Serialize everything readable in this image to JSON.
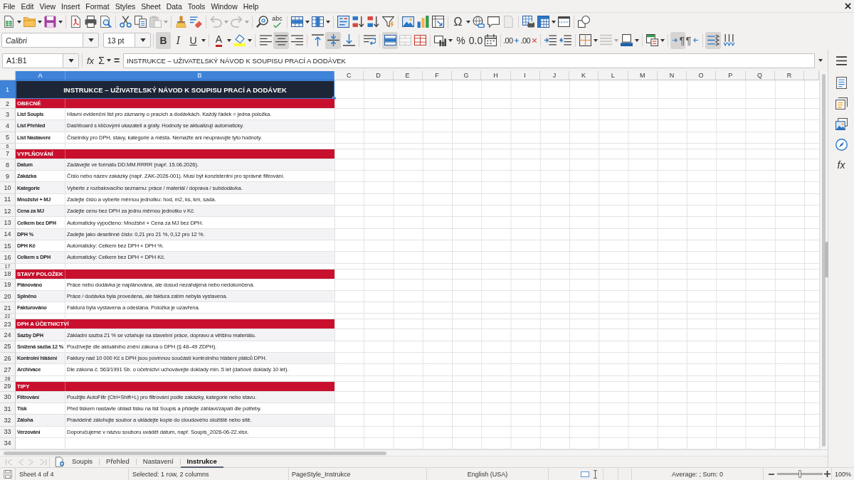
{
  "menu_bar": [
    "File",
    "Edit",
    "View",
    "Insert",
    "Format",
    "Styles",
    "Sheet",
    "Data",
    "Tools",
    "Window",
    "Help"
  ],
  "standard_toolbar": {
    "paste": {
      "disabled": true
    },
    "undo": {
      "disabled": true
    },
    "redo": {
      "disabled": true
    },
    "spelling": {
      "glyph": "abc"
    },
    "special_character": {
      "glyph": "Ω"
    },
    "headers_footers": {
      "disabled": true
    }
  },
  "formatting_toolbar": {
    "font_name": "Calibri",
    "font_size": "13 pt",
    "bold": {
      "glyph": "B",
      "on": true
    },
    "italic": {
      "glyph": "I",
      "on": false
    },
    "underline": {
      "glyph": "U",
      "on": false
    },
    "font_color": {
      "glyph": "A"
    },
    "align_left": {
      "on": false
    },
    "align_center": {
      "on": true
    },
    "align_right": {
      "on": false
    },
    "align_top": {
      "on": false
    },
    "align_middle": {
      "on": true
    },
    "align_bottom": {
      "on": false
    },
    "wrap_text": {
      "on": false
    },
    "merge_and_center": {
      "on": true
    },
    "merge_cells": {
      "disabled": true
    },
    "percent": {
      "glyph": "%"
    },
    "standard_format": {
      "glyph": "0.0"
    },
    "add_decimal": {
      "glyph": ".00"
    },
    "delete_decimal": {
      "glyph": ".00"
    },
    "border_style": {
      "disabled": true
    },
    "left_to_right": {
      "glyph": "¶",
      "on": true
    },
    "right_to_left": {
      "glyph": "¶",
      "on": false
    },
    "text_horizontal": {
      "on": true
    },
    "text_vertical": {
      "on": false
    }
  },
  "formula_bar": {
    "name_box": "A1:B1",
    "function_wizard": "fx",
    "sum": "Σ",
    "formula": "=",
    "content": "INSTRUKCE – UŽIVATELSKÝ NÁVOD K SOUPISU PRACÍ A DODÁVEK"
  },
  "columns": [
    {
      "label": "A",
      "selected": true
    },
    {
      "label": "B",
      "selected": true
    },
    {
      "label": "C",
      "selected": false
    },
    {
      "label": "D",
      "selected": false
    },
    {
      "label": "E",
      "selected": false
    },
    {
      "label": "F",
      "selected": false
    },
    {
      "label": "G",
      "selected": false
    },
    {
      "label": "H",
      "selected": false
    },
    {
      "label": "I",
      "selected": false
    },
    {
      "label": "J",
      "selected": false
    },
    {
      "label": "K",
      "selected": false
    },
    {
      "label": "L",
      "selected": false
    },
    {
      "label": "M",
      "selected": false
    },
    {
      "label": "N",
      "selected": false
    },
    {
      "label": "O",
      "selected": false
    },
    {
      "label": "P",
      "selected": false
    },
    {
      "label": "Q",
      "selected": false
    },
    {
      "label": "R",
      "selected": false
    }
  ],
  "rows": [
    {
      "number": "1",
      "selected": true,
      "kind": "title",
      "text": "INSTRUKCE – UŽIVATELSKÝ NÁVOD K SOUPISU PRACÍ A DODÁVEK"
    },
    {
      "number": "2",
      "selected": false,
      "kind": "section",
      "text": "OBECNÉ"
    },
    {
      "number": "3",
      "selected": false,
      "kind": "entry",
      "label": "List Soupis",
      "text": "Hlavní evidenční list pro záznamy o pracích a dodávkách. Každý řádek = jedna položka."
    },
    {
      "number": "4",
      "selected": false,
      "kind": "entry",
      "label": "List Přehled",
      "text": "Dashboard s klíčovými ukazateli a grafy. Hodnoty se aktualizují automaticky."
    },
    {
      "number": "5",
      "selected": false,
      "kind": "entry",
      "label": "List Nastavení",
      "text": "Číselníky pro DPH, stavy, kategorie a města. Nemažte ani neupravujte tyto hodnoty."
    },
    {
      "number": "6",
      "selected": false,
      "kind": "spacer"
    },
    {
      "number": "7",
      "selected": false,
      "kind": "section",
      "text": "VYPLŇOVÁNÍ"
    },
    {
      "number": "8",
      "selected": false,
      "kind": "entry",
      "label": "Datum",
      "text": "Zadávejte ve formátu DD.MM.RRRR (např. 15.06.2026)."
    },
    {
      "number": "9",
      "selected": false,
      "kind": "entry",
      "label": "Zakázka",
      "text": "Číslo nebo název zakázky (např. ZAK-2026-001). Musí být konzistentní pro správné filtrování."
    },
    {
      "number": "10",
      "selected": false,
      "kind": "entry",
      "label": "Kategorie",
      "text": "Vyberte z rozbalovacího seznamu: práce / materiál / doprava / subdodávka."
    },
    {
      "number": "11",
      "selected": false,
      "kind": "entry",
      "label": "Množství + MJ",
      "text": "Zadejte číslo a vyberte měrnou jednotku: hod, m2, ks, km, sada."
    },
    {
      "number": "12",
      "selected": false,
      "kind": "entry",
      "label": "Cena za MJ",
      "text": "Zadejte cenu bez DPH za jednu měrnou jednotku v Kč."
    },
    {
      "number": "13",
      "selected": false,
      "kind": "entry",
      "label": "Celkem bez DPH",
      "text": "Automaticky vypočteno: Množství × Cena za MJ bez DPH."
    },
    {
      "number": "14",
      "selected": false,
      "kind": "entry",
      "label": "DPH %",
      "text": "Zadejte jako desetinné číslo: 0,21 pro 21 %, 0,12 pro 12 %."
    },
    {
      "number": "15",
      "selected": false,
      "kind": "entry",
      "label": "DPH Kč",
      "text": "Automaticky: Celkem bez DPH × DPH %."
    },
    {
      "number": "16",
      "selected": false,
      "kind": "entry",
      "label": "Celkem s DPH",
      "text": "Automaticky: Celkem bez DPH + DPH Kč."
    },
    {
      "number": "17",
      "selected": false,
      "kind": "spacer"
    },
    {
      "number": "18",
      "selected": false,
      "kind": "section",
      "text": "STAVY POLOŽEK"
    },
    {
      "number": "19",
      "selected": false,
      "kind": "entry",
      "label": "Plánováno",
      "text": "Práce nebo dodávka je naplánována, ale dosud nezahájená nebo nedokončená."
    },
    {
      "number": "20",
      "selected": false,
      "kind": "entry",
      "label": "Splněno",
      "text": "Práce / dodávka byla provedena, ale faktura zatím nebyla vystavena."
    },
    {
      "number": "21",
      "selected": false,
      "kind": "entry",
      "label": "Fakturováno",
      "text": "Faktura byla vystavena a odeslána. Položka je uzavřena."
    },
    {
      "number": "22",
      "selected": false,
      "kind": "spacer"
    },
    {
      "number": "23",
      "selected": false,
      "kind": "section",
      "text": "DPH A ÚČETNICTVÍ"
    },
    {
      "number": "24",
      "selected": false,
      "kind": "entry",
      "label": "Sazby DPH",
      "text": "Základní sazba 21 % se vztahuje na stavební práce, dopravu a většinu materiálu."
    },
    {
      "number": "25",
      "selected": false,
      "kind": "entry",
      "label": "Snížená sazba 12 %",
      "text": "Používejte dle aktuálního znění zákona o DPH (§ 48–49 ZDPH)."
    },
    {
      "number": "26",
      "selected": false,
      "kind": "entry",
      "label": "Kontrolní hlášení",
      "text": "Faktury nad 10 000 Kč s DPH jsou povinnou součástí kontrolního hlášení plátců DPH."
    },
    {
      "number": "27",
      "selected": false,
      "kind": "entry",
      "label": "Archivace",
      "text": "Dle zákona č. 563/1991 Sb. o účetnictví uchovávejte doklady min. 5 let (daňové doklady 10 let)."
    },
    {
      "number": "28",
      "selected": false,
      "kind": "spacer"
    },
    {
      "number": "29",
      "selected": false,
      "kind": "section",
      "text": "TIPY"
    },
    {
      "number": "30",
      "selected": false,
      "kind": "entry",
      "label": "Filtrování",
      "text": "Použijte AutoFiltr (Ctrl+Shift+L) pro filtrování podle zakázky, kategorie nebo stavu."
    },
    {
      "number": "31",
      "selected": false,
      "kind": "entry",
      "label": "Tisk",
      "text": "Před tiskem nastavte oblast tisku na list Soupis a přidejte záhlaví/zápatí dle potřeby."
    },
    {
      "number": "32",
      "selected": false,
      "kind": "entry",
      "label": "Záloha",
      "text": "Pravidelně zálohujte soubor a ukládejte kopie do cloudového úložiště nebo sítě."
    },
    {
      "number": "33",
      "selected": false,
      "kind": "entry",
      "label": "Verzování",
      "text": "Doporučujeme v názvu souboru uvádět datum, např. Soupis_2026-06-22.xlsx."
    },
    {
      "number": "34",
      "selected": false,
      "kind": "blank"
    }
  ],
  "sidebar": {
    "functions": "fx"
  },
  "sheet_navigation": [
    {
      "disabled": true
    },
    {
      "disabled": true
    },
    {
      "disabled": true
    },
    {
      "disabled": true
    }
  ],
  "sheet_tabs": [
    {
      "label": "Soupis",
      "selected": false
    },
    {
      "label": "Přehled",
      "selected": false
    },
    {
      "label": "Nastavení",
      "selected": false
    },
    {
      "label": "Instrukce",
      "selected": true
    }
  ],
  "status_bar": {
    "sheet": "Sheet 4 of 4",
    "selection": "Selected: 1 row, 2 columns",
    "page_style": "PageStyle_Instrukce",
    "language": "English (USA)",
    "summary": "Average: ; Sum: 0",
    "zoom_slider": {
      "level": 0.5
    },
    "zoom": "100%"
  }
}
